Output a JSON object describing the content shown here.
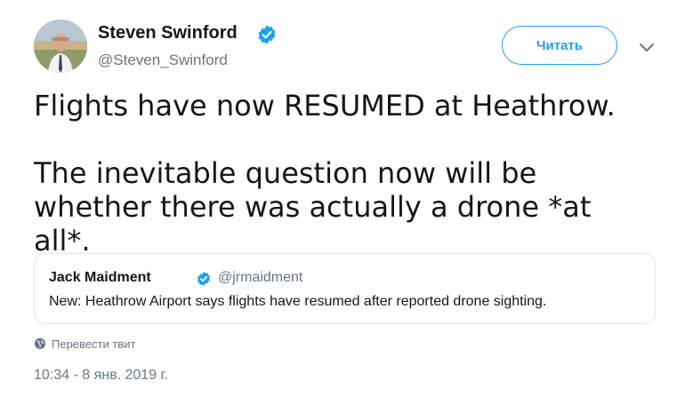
{
  "author": {
    "name": "Steven Swinford",
    "handle": "@Steven_Swinford",
    "verified": true,
    "avatar_icon": "profile-photo"
  },
  "follow_button": {
    "label": "Читать"
  },
  "menu_icon": "chevron-down-icon",
  "tweet": {
    "paragraphs": [
      "Flights have now RESUMED at Heathrow.",
      "The inevitable question now will be whether there was actually a drone *at all*."
    ]
  },
  "quoted_tweet": {
    "name": "Jack Maidment",
    "handle": "@jrmaidment",
    "verified": true,
    "text": "New: Heathrow Airport says flights have resumed after reported drone sighting."
  },
  "translate": {
    "label": "Перевести твит",
    "icon": "globe-icon"
  },
  "timestamp": "10:34 - 8 янв. 2019 г.",
  "colors": {
    "accent": "#1da1f2",
    "text": "#14171a",
    "secondary_text": "#657786",
    "border": "#e1e8ed"
  }
}
